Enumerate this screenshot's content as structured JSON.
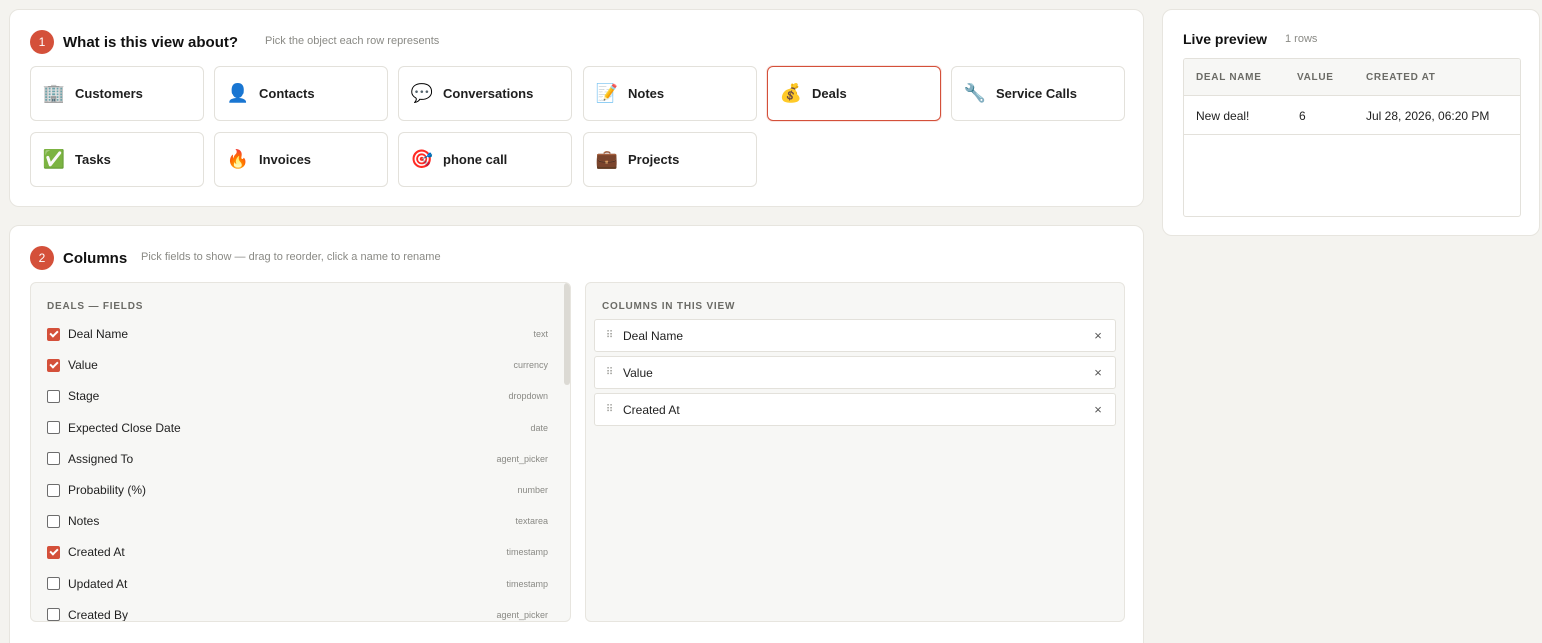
{
  "object_section": {
    "step": "1",
    "title": "What is this view about?",
    "hint": "Pick the object each row represents",
    "objects": [
      {
        "label": "Customers",
        "icon": "🏢",
        "icon_name": "office-building-icon"
      },
      {
        "label": "Contacts",
        "icon": "👤",
        "icon_name": "person-icon"
      },
      {
        "label": "Conversations",
        "icon": "💬",
        "icon_name": "speech-bubble-icon"
      },
      {
        "label": "Notes",
        "icon": "📝",
        "icon_name": "memo-icon"
      },
      {
        "label": "Deals",
        "icon": "💰",
        "icon_name": "money-bag-icon",
        "selected": true
      },
      {
        "label": "Service Calls",
        "icon": "🔧",
        "icon_name": "wrench-icon"
      },
      {
        "label": "Tasks",
        "icon": "✅",
        "icon_name": "check-box-icon"
      },
      {
        "label": "Invoices",
        "icon": "🔥",
        "icon_name": "fire-icon"
      },
      {
        "label": "phone call",
        "icon": "🎯",
        "icon_name": "target-icon"
      },
      {
        "label": "Projects",
        "icon": "💼",
        "icon_name": "briefcase-icon"
      }
    ]
  },
  "columns_section": {
    "step": "2",
    "title": "Columns",
    "hint": "Pick fields to show — drag to reorder, click a name to rename",
    "fields_heading": "DEALS — FIELDS",
    "fields": [
      {
        "name": "Deal Name",
        "type": "text",
        "checked": true
      },
      {
        "name": "Value",
        "type": "currency",
        "checked": true
      },
      {
        "name": "Stage",
        "type": "dropdown",
        "checked": false
      },
      {
        "name": "Expected Close Date",
        "type": "date",
        "checked": false
      },
      {
        "name": "Assigned To",
        "type": "agent_picker",
        "checked": false
      },
      {
        "name": "Probability (%)",
        "type": "number",
        "checked": false
      },
      {
        "name": "Notes",
        "type": "textarea",
        "checked": false
      },
      {
        "name": "Created At",
        "type": "timestamp",
        "checked": true
      },
      {
        "name": "Updated At",
        "type": "timestamp",
        "checked": false
      },
      {
        "name": "Created By",
        "type": "agent_picker",
        "checked": false
      }
    ],
    "view_heading": "COLUMNS IN THIS VIEW",
    "view_columns": [
      {
        "name": "Deal Name"
      },
      {
        "name": "Value"
      },
      {
        "name": "Created At"
      }
    ],
    "drag_glyph": "⠿",
    "remove_glyph": "×"
  },
  "preview": {
    "title": "Live preview",
    "count": "1 rows",
    "headers": [
      "DEAL NAME",
      "VALUE",
      "CREATED AT"
    ],
    "rows": [
      [
        "New deal!",
        "6",
        "Jul 28, 2026, 06:20 PM"
      ]
    ]
  },
  "colors": {
    "accent": "#d4503a",
    "background": "#f4f3ef",
    "card": "#ffffff"
  }
}
